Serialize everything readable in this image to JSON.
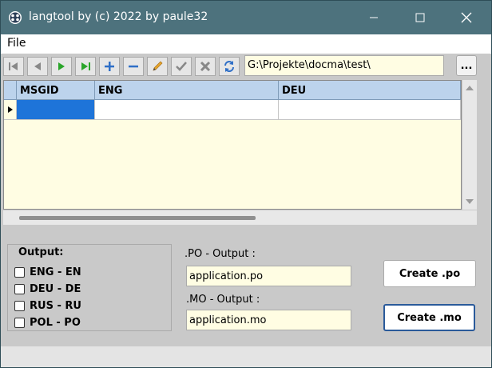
{
  "window": {
    "title": "langtool by (c) 2022 by paule32"
  },
  "menu": {
    "file": "File"
  },
  "toolbar": {
    "buttons": [
      "first-icon",
      "prior-icon",
      "next-icon",
      "last-icon",
      "add-icon",
      "remove-icon",
      "edit-icon",
      "post-icon",
      "cancel-icon",
      "refresh-icon"
    ],
    "path": "G:\\Projekte\\docma\\test\\",
    "browse_label": "..."
  },
  "grid": {
    "columns": [
      "MSGID",
      "ENG",
      "DEU"
    ],
    "rows": [
      [
        "",
        "",
        ""
      ]
    ]
  },
  "output": {
    "title": "Output:",
    "languages": [
      {
        "label": "ENG - EN",
        "checked": false
      },
      {
        "label": "DEU - DE",
        "checked": false
      },
      {
        "label": "RUS - RU",
        "checked": false
      },
      {
        "label": "POL - PO",
        "checked": false
      }
    ]
  },
  "po": {
    "label": ".PO - Output :",
    "value": "application.po"
  },
  "mo": {
    "label": ".MO - Output :",
    "value": "application.mo"
  },
  "buttons": {
    "create_po": "Create .po",
    "create_mo": "Create .mo"
  },
  "colors": {
    "titlebar": "#4d727d",
    "grid_header": "#bcd3ec",
    "selected_cell": "#1e74d9",
    "input_bg": "#fffde3"
  }
}
